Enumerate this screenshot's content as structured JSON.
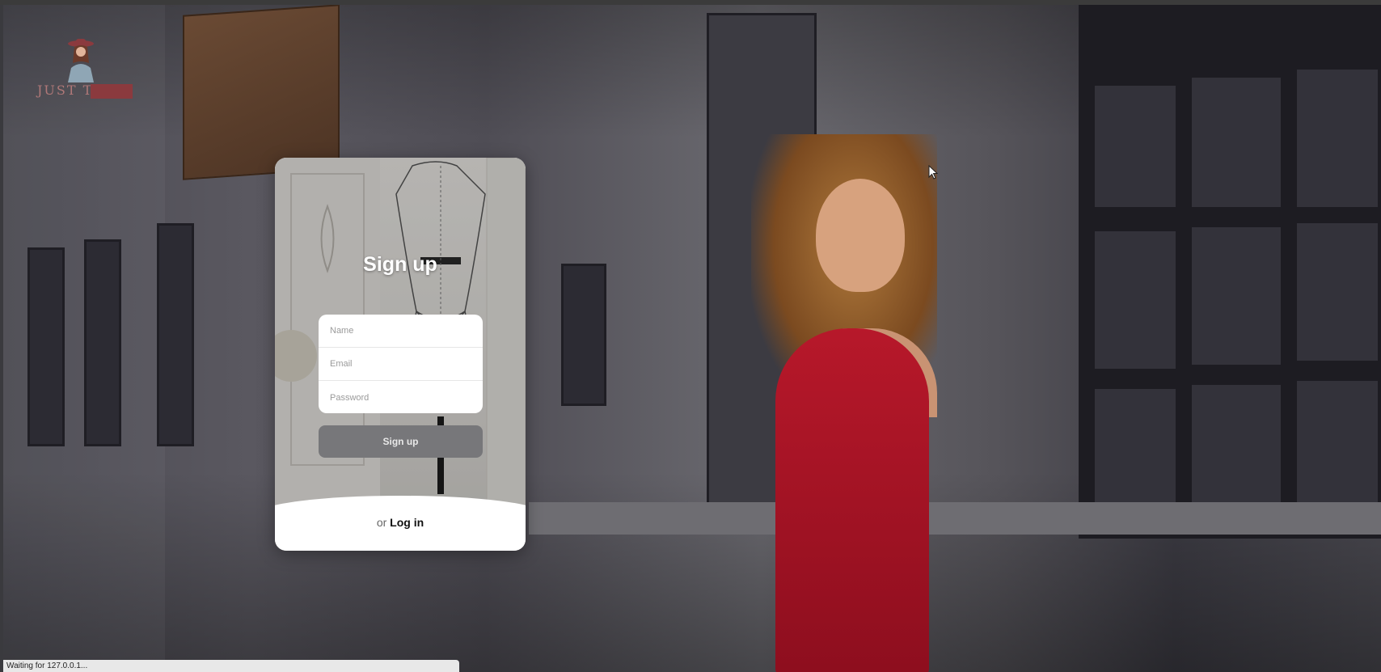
{
  "logo": {
    "text": "JUST T",
    "icon": "girl-with-hat-logo-icon"
  },
  "signup_card": {
    "title": "Sign up",
    "fields": {
      "name_placeholder": "Name",
      "email_placeholder": "Email",
      "password_placeholder": "Password"
    },
    "submit_label": "Sign up",
    "footer_prefix": "or",
    "login_link": "Log in"
  },
  "status": {
    "text": "Waiting for 127.0.0.1..."
  },
  "colors": {
    "button_bg": "#77777a",
    "card_footer": "#ffffff",
    "dress": "#b7182a"
  }
}
